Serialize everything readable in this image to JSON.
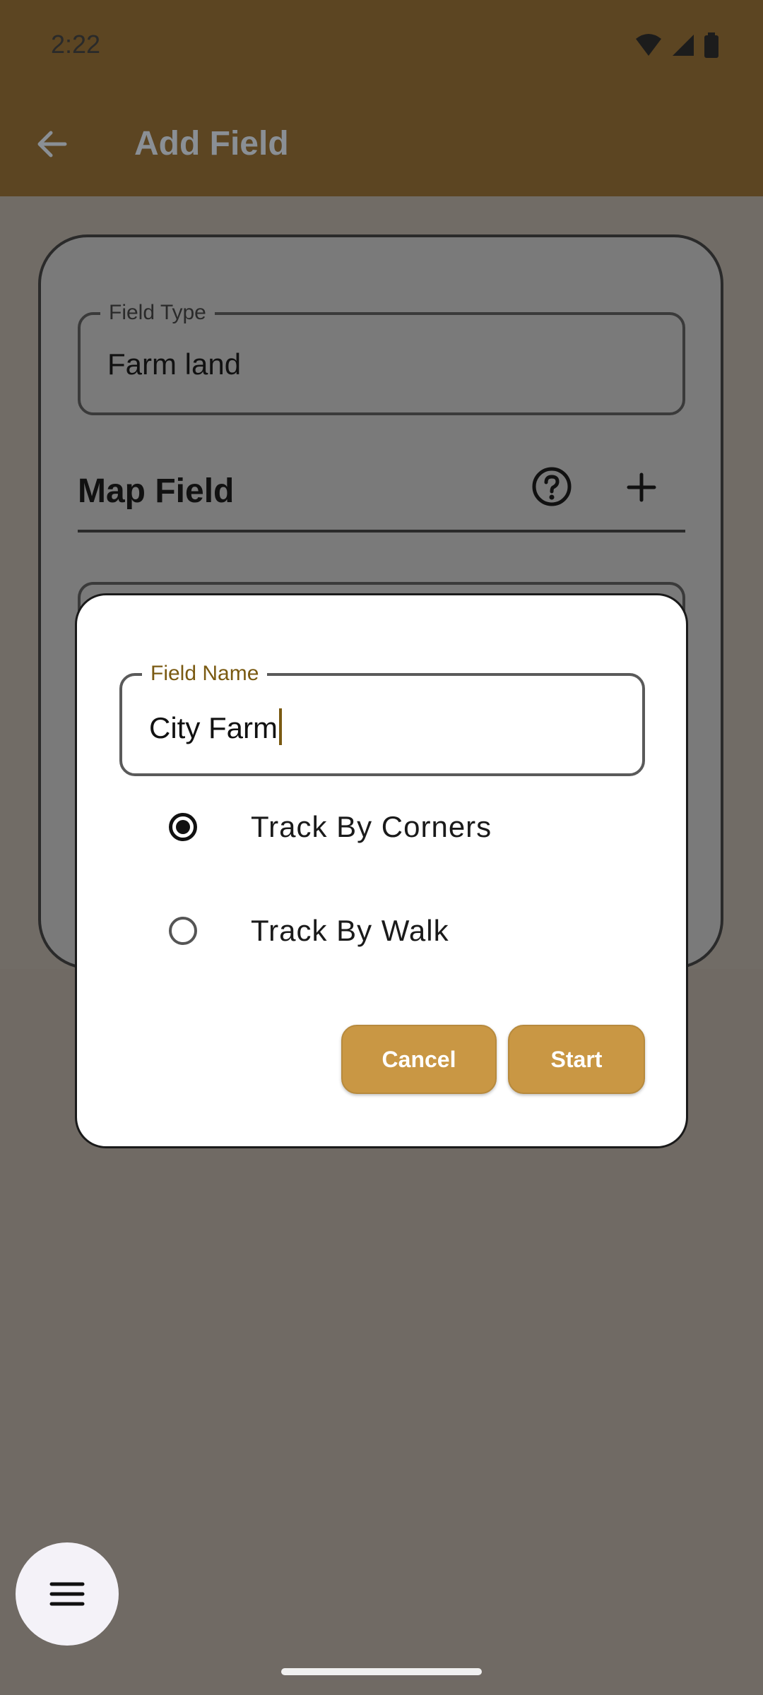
{
  "status_bar": {
    "time": "2:22",
    "icons": [
      "wifi-icon",
      "signal-icon",
      "battery-icon"
    ]
  },
  "app_bar": {
    "title": "Add Field",
    "back_icon": "arrow-back-icon"
  },
  "form": {
    "field_type": {
      "label": "Field Type",
      "value": "Farm land"
    },
    "map_field": {
      "label": "Map Field",
      "help_icon": "help-circle-icon",
      "add_icon": "plus-icon"
    }
  },
  "dialog": {
    "field_name": {
      "label": "Field Name",
      "value": "City Farm"
    },
    "options": [
      {
        "label": "Track By Corners",
        "selected": true
      },
      {
        "label": "Track By Walk",
        "selected": false
      }
    ],
    "cancel_label": "Cancel",
    "start_label": "Start"
  },
  "fab": {
    "icon": "menu-icon"
  },
  "colors": {
    "accent": "#c99744",
    "app_bar": "#5c4522",
    "legend_accent": "#7a5a12"
  }
}
